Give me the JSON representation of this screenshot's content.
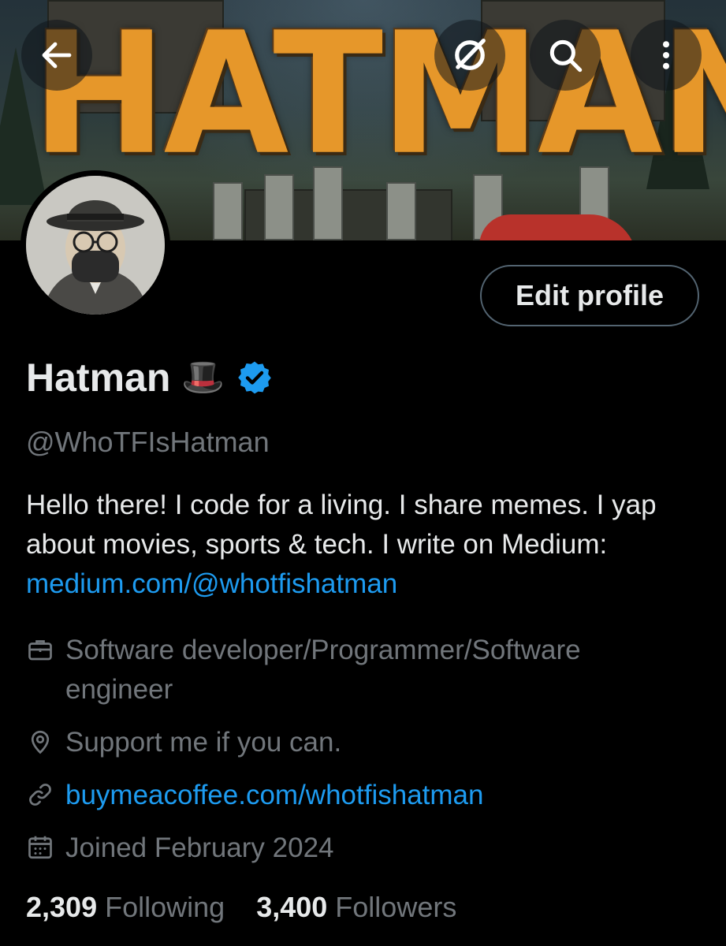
{
  "banner": {
    "title": "HATMAN"
  },
  "topbar": {
    "back_icon": "arrow-left-icon",
    "grok_icon": "grok-icon",
    "search_icon": "search-icon",
    "more_icon": "more-vertical-icon"
  },
  "profile": {
    "edit_label": "Edit profile",
    "name": "Hatman",
    "name_emoji": "🎩",
    "verified_icon": "verified-badge-icon",
    "handle": "@WhoTFIsHatman",
    "bio_text": "Hello there! I code for a living. I share memes. I yap about movies, sports & tech. I write on Medium: ",
    "bio_link": "medium.com/@whotfishatman",
    "profession": "Software developer/Programmer/Software engineer",
    "location": "Support me if you can.",
    "website": "buymeacoffee.com/whotfishatman",
    "joined": "Joined February 2024"
  },
  "stats": {
    "following_count": "2,309",
    "following_label": "Following",
    "followers_count": "3,400",
    "followers_label": "Followers"
  },
  "colors": {
    "background": "#000000",
    "text": "#e7e9ea",
    "muted": "#71767b",
    "link": "#1d9bf0",
    "border": "#536471"
  }
}
